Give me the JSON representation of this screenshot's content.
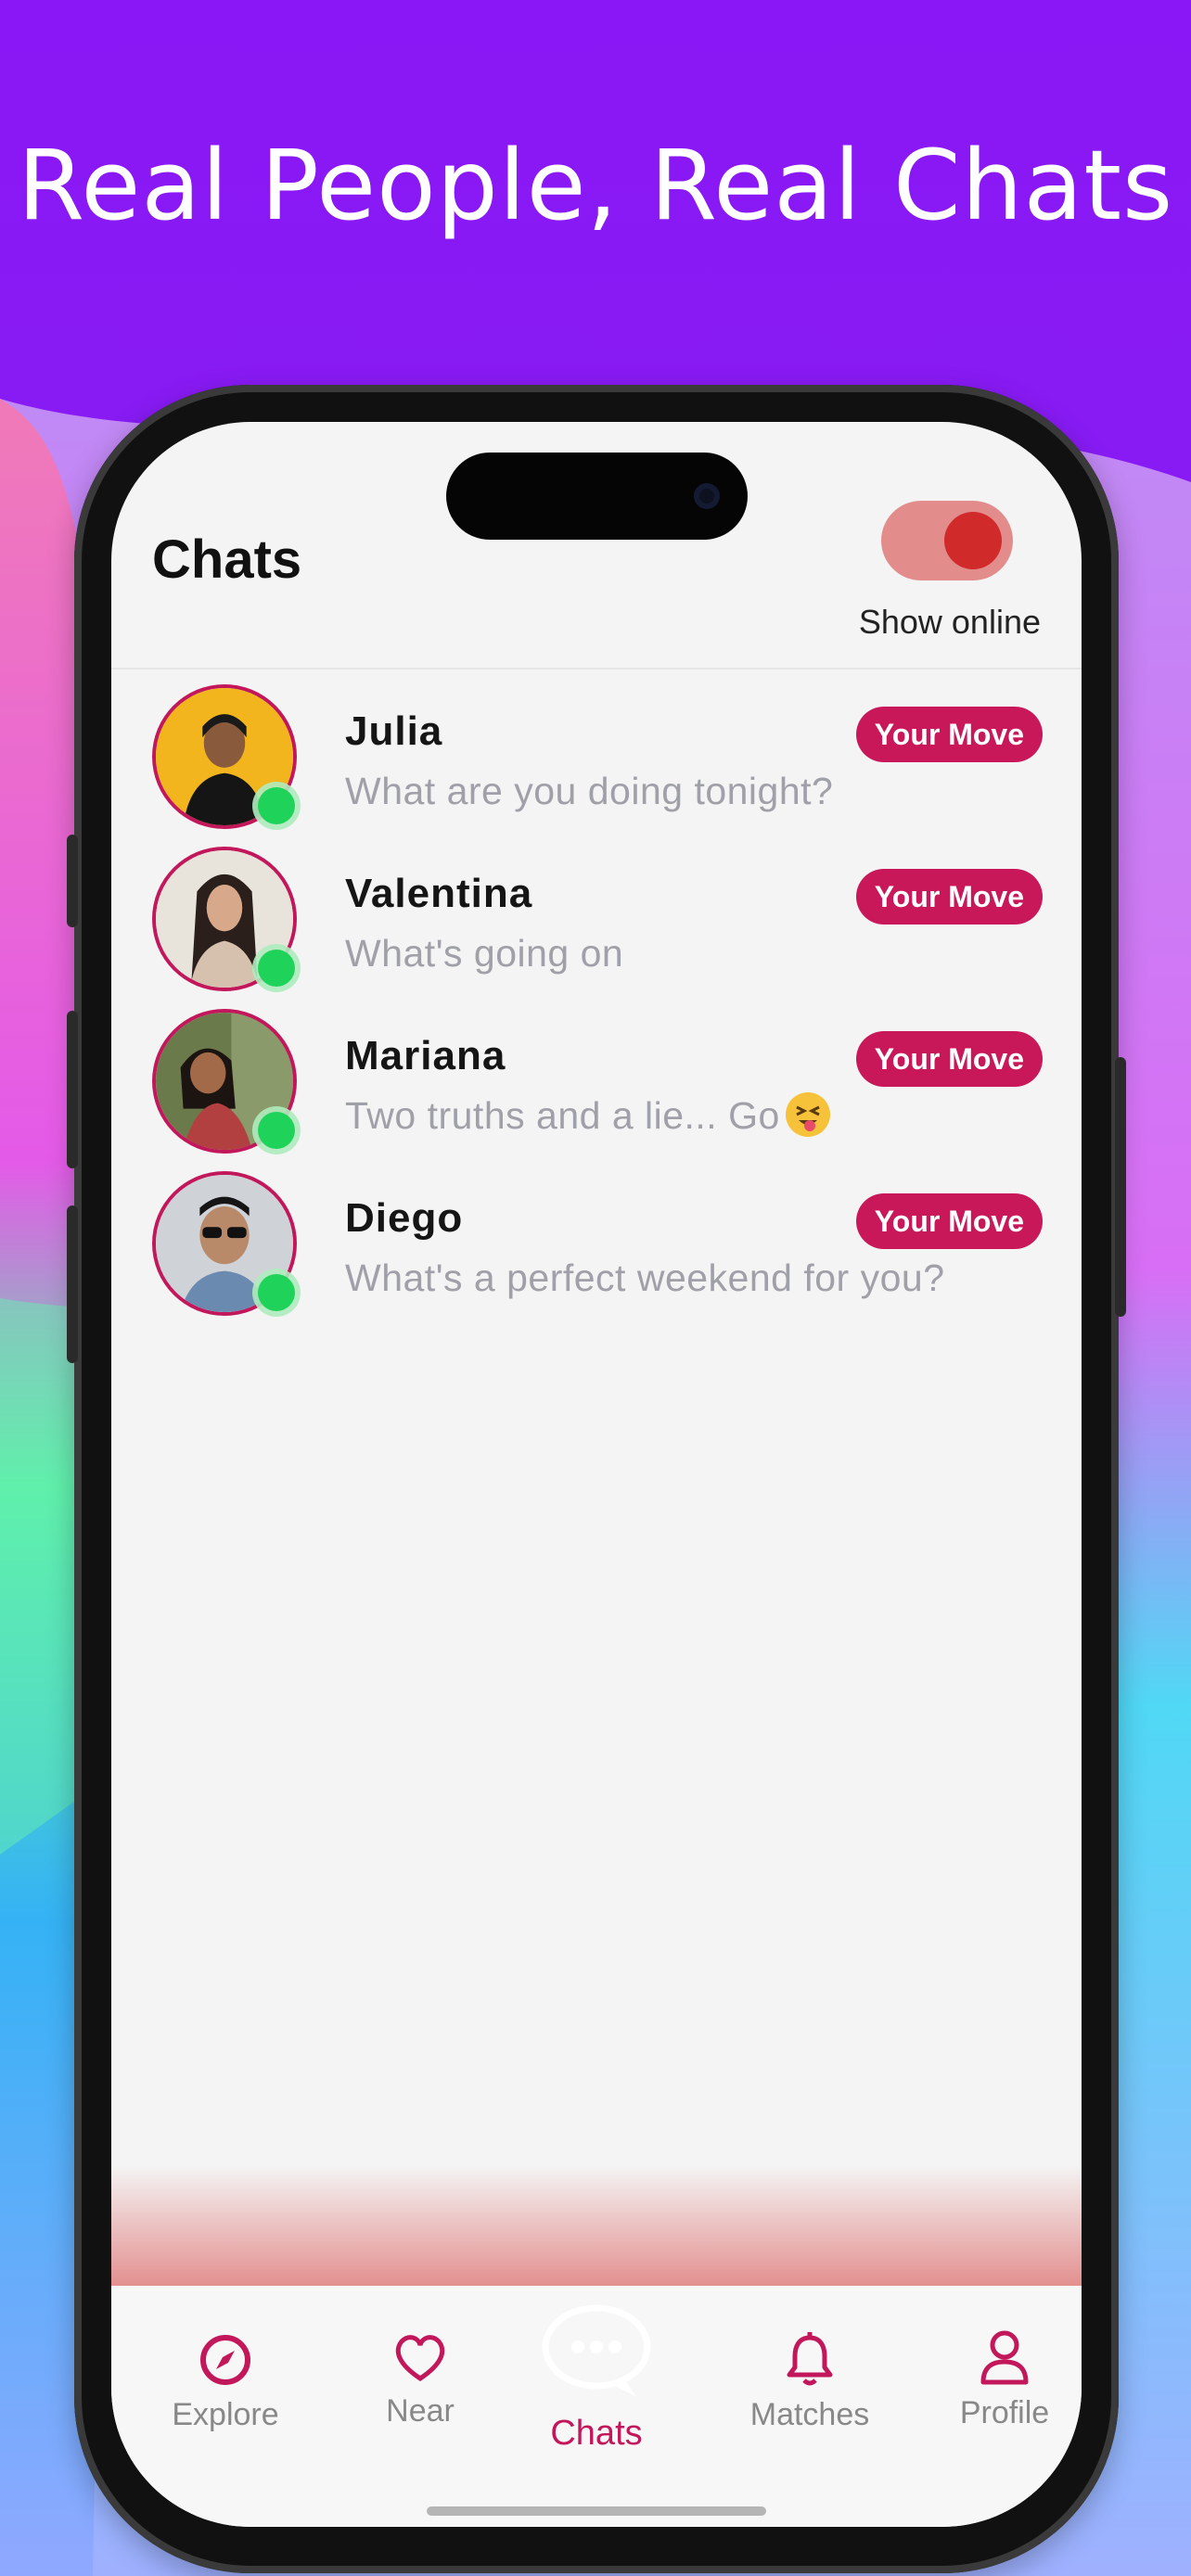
{
  "headline": "Real People, Real Chats",
  "header": {
    "title": "Chats",
    "toggle_label": "Show online",
    "toggle_on": true
  },
  "chats": [
    {
      "name": "Julia",
      "message": "What are you doing tonight?",
      "badge": "Your Move",
      "online": true
    },
    {
      "name": "Valentina",
      "message": "What's going on",
      "badge": "Your Move",
      "online": true
    },
    {
      "name": "Mariana",
      "message": "Two truths and a lie... Go",
      "badge": "Your Move",
      "online": true,
      "emoji": "squinting-tongue-emoji"
    },
    {
      "name": "Diego",
      "message": "What's a perfect weekend for you?",
      "badge": "Your Move",
      "online": true
    }
  ],
  "tabs": [
    {
      "label": "Explore",
      "icon": "compass-icon",
      "active": false
    },
    {
      "label": "Near",
      "icon": "heart-icon",
      "active": false
    },
    {
      "label": "Chats",
      "icon": "chat-bubble-icon",
      "active": true
    },
    {
      "label": "Matches",
      "icon": "bell-icon",
      "active": false
    },
    {
      "label": "Profile",
      "icon": "user-icon",
      "active": false
    }
  ],
  "colors": {
    "accent": "#c2185b",
    "online": "#1fd35a",
    "badge_bg": "#c8185a",
    "toggle_track": "#e38c8c",
    "toggle_knob": "#d12a2a"
  }
}
